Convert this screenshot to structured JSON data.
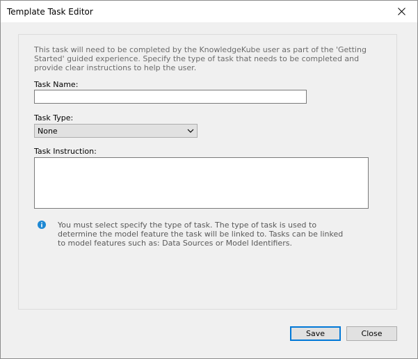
{
  "window": {
    "title": "Template Task Editor",
    "close_icon": "close-icon"
  },
  "form": {
    "intro": "This task will need to be completed by the KnowledgeKube user as part of the 'Getting Started' guided experience. Specify the type of task that needs to be completed and provide clear instructions to help the user.",
    "task_name_label": "Task Name:",
    "task_name_value": "",
    "task_type_label": "Task Type:",
    "task_type_value": "None",
    "task_instruction_label": "Task Instruction:",
    "task_instruction_value": "",
    "info_icon": "info-icon",
    "info_text": "You must select specify the type of task. The type of task is used to determine the model feature the task will be linked to. Tasks can be linked to model features such as: Data Sources or Model Identifiers."
  },
  "buttons": {
    "save": "Save",
    "close": "Close"
  },
  "colors": {
    "info_blue": "#1e88d3",
    "default_button_border": "#0078d7"
  }
}
